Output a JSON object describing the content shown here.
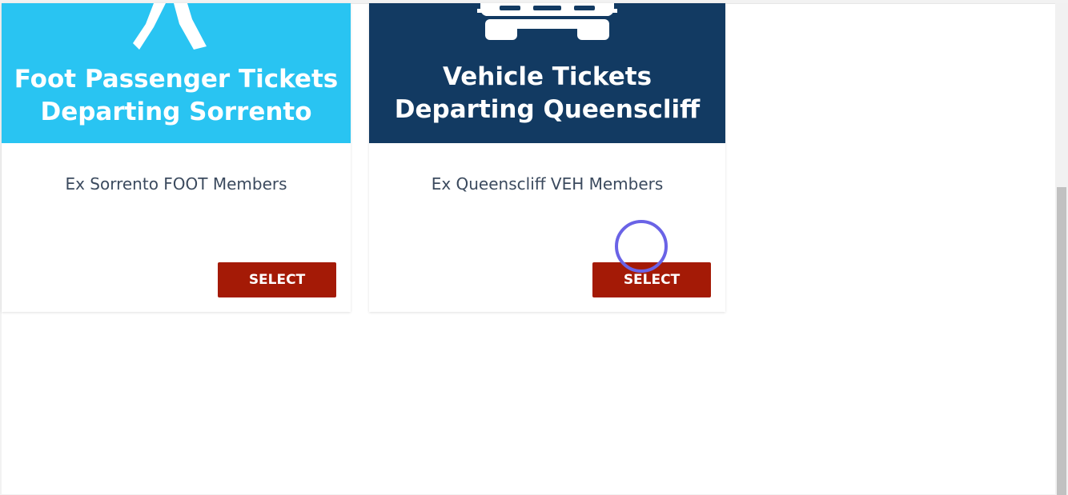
{
  "cards": [
    {
      "banner_line1": "Foot Passenger Tickets",
      "banner_line2": "Departing Sorrento",
      "banner_icon": "walking-person-icon",
      "banner_color": "#29c4f2",
      "subtitle": "Ex Sorrento FOOT Members",
      "button_label": "SELECT"
    },
    {
      "banner_line1": "Vehicle Tickets",
      "banner_line2": "Departing Queenscliff",
      "banner_icon": "car-icon",
      "banner_color": "#123a62",
      "subtitle": "Ex Queenscliff VEH Members",
      "button_label": "SELECT"
    }
  ],
  "colors": {
    "button": "#a41a06",
    "click_indicator": "#6a63e6"
  }
}
